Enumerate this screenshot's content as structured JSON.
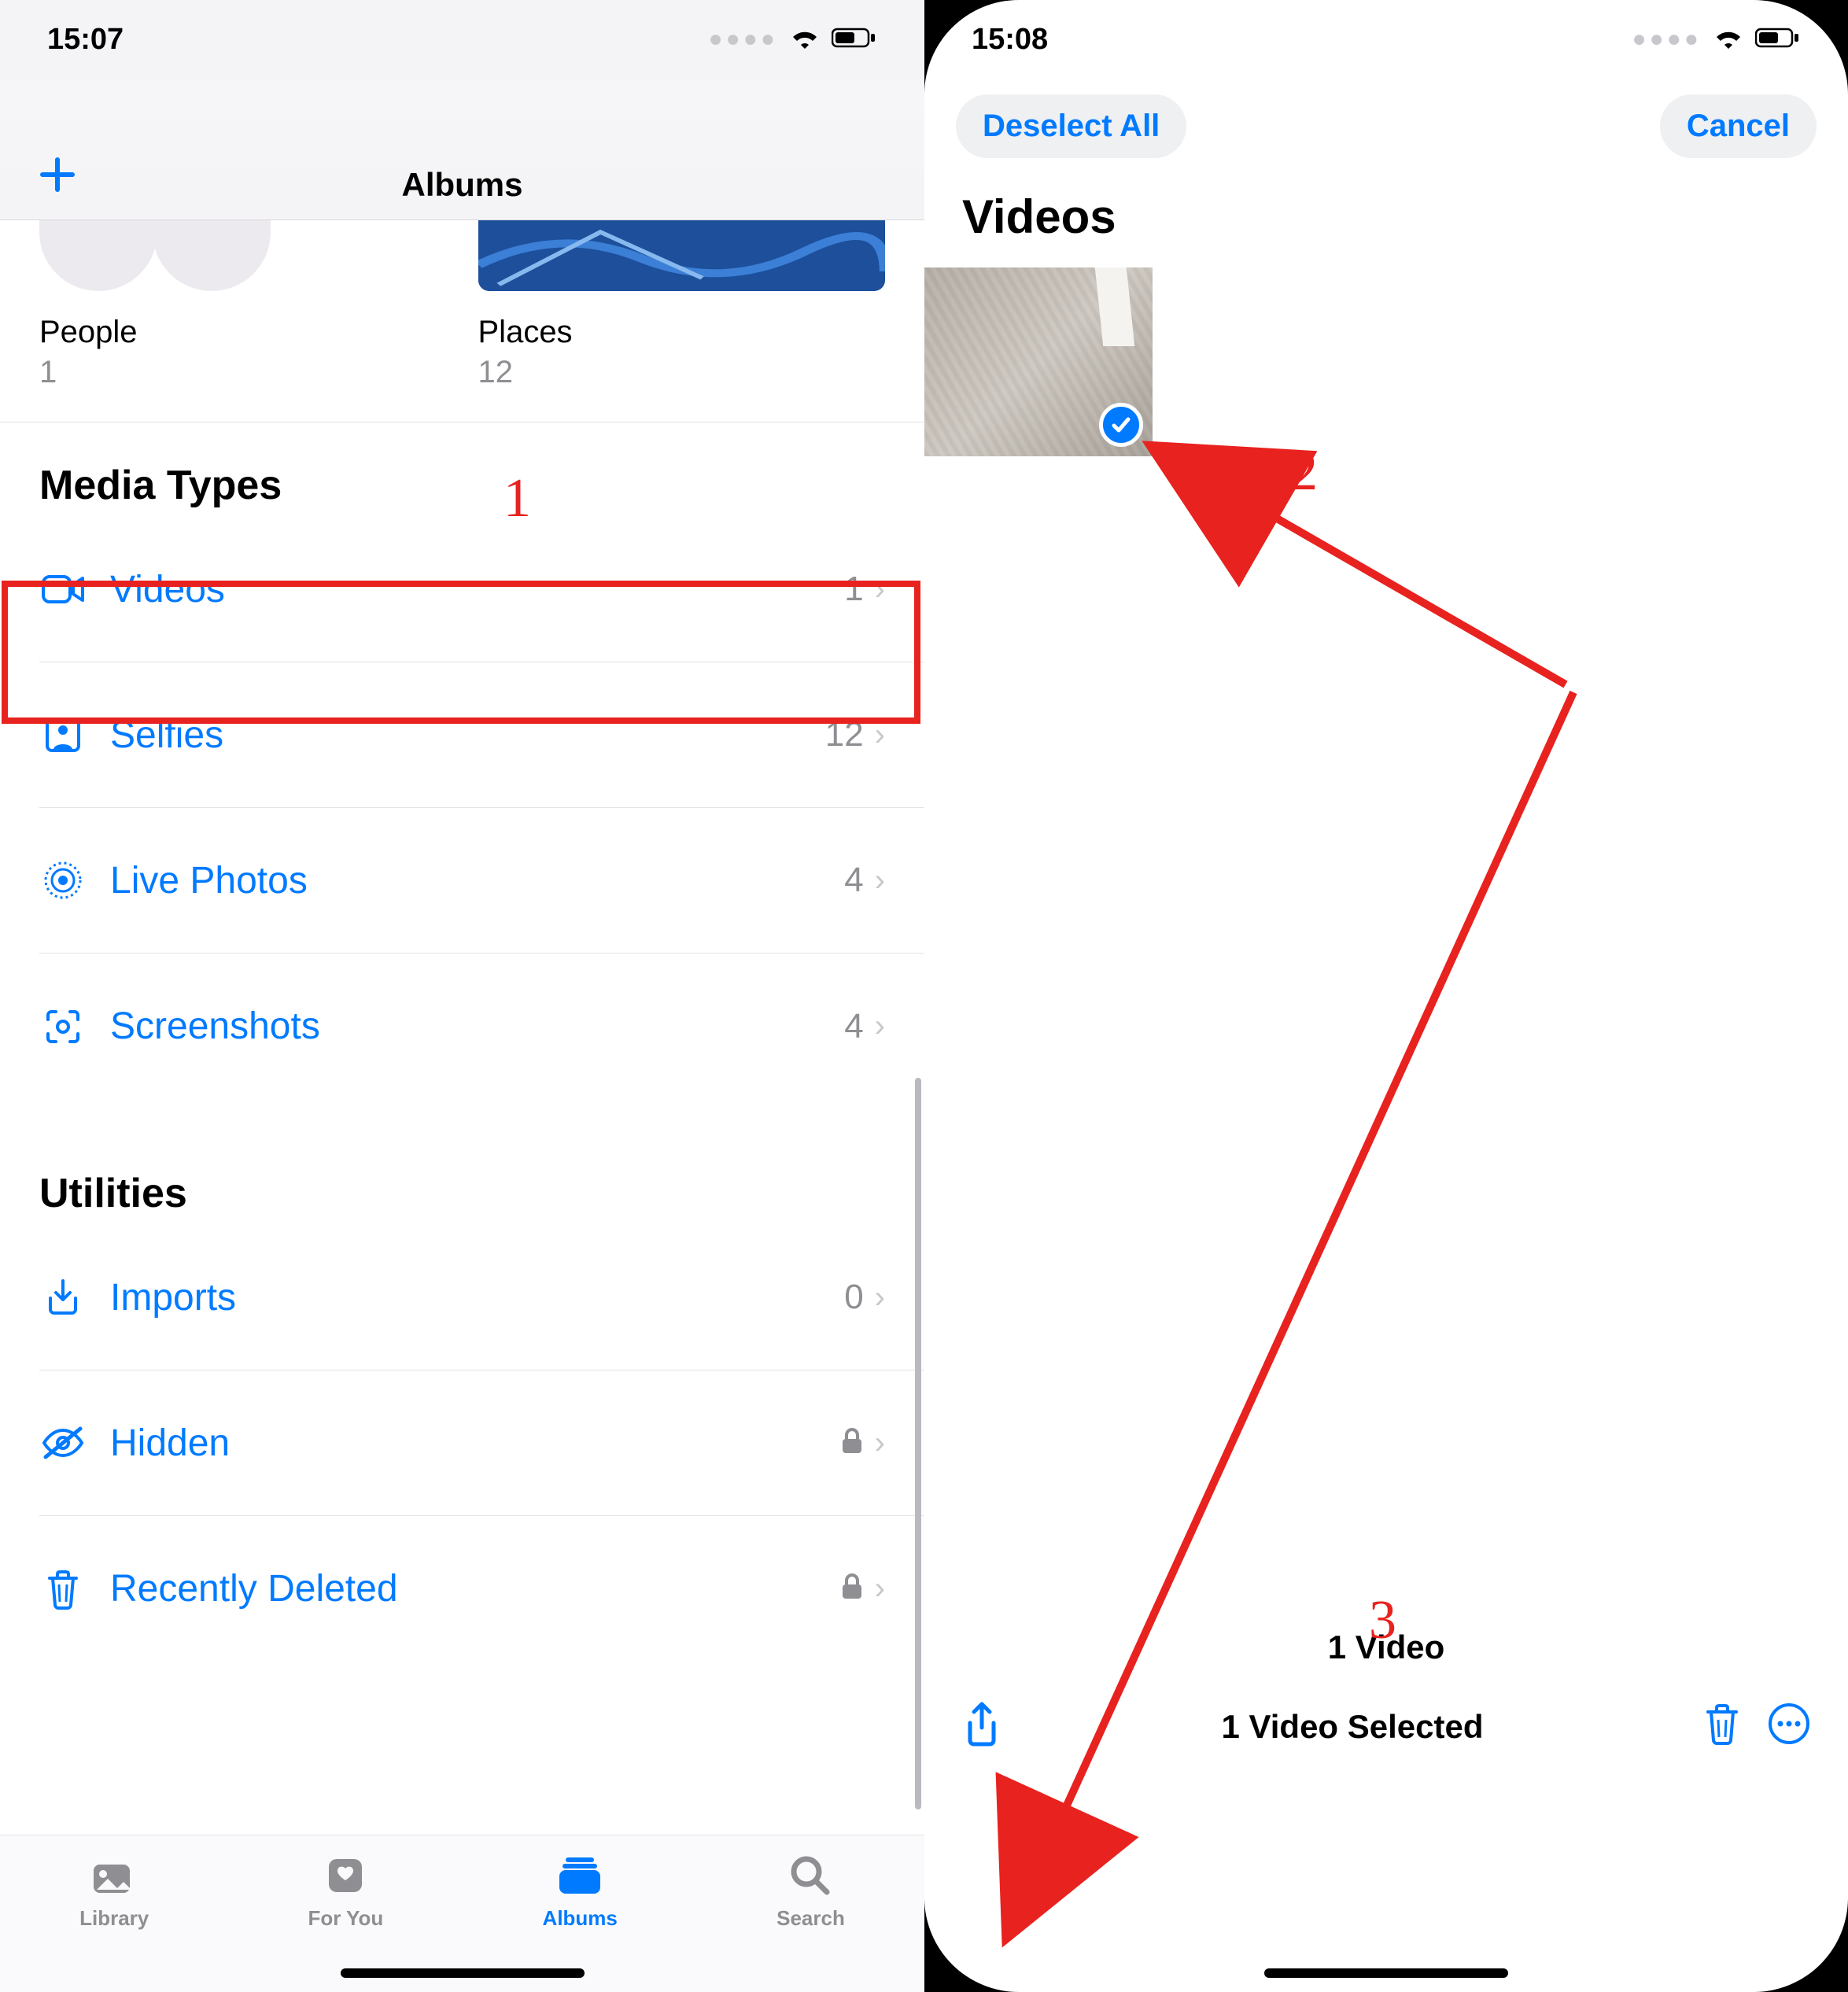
{
  "left": {
    "status": {
      "time": "15:07"
    },
    "header": {
      "title": "Albums"
    },
    "people_places": {
      "people": {
        "label": "People",
        "count": "1"
      },
      "places": {
        "label": "Places",
        "count": "12"
      }
    },
    "sections": {
      "media_types": {
        "title": "Media Types",
        "rows": [
          {
            "icon": "video-icon",
            "label": "Videos",
            "count": "1"
          },
          {
            "icon": "selfie-icon",
            "label": "Selfies",
            "count": "12"
          },
          {
            "icon": "livephoto-icon",
            "label": "Live Photos",
            "count": "4"
          },
          {
            "icon": "screenshot-icon",
            "label": "Screenshots",
            "count": "4"
          }
        ]
      },
      "utilities": {
        "title": "Utilities",
        "rows": [
          {
            "icon": "import-icon",
            "label": "Imports",
            "count": "0"
          },
          {
            "icon": "hidden-icon",
            "label": "Hidden",
            "locked": true
          },
          {
            "icon": "trash-icon",
            "label": "Recently Deleted",
            "locked": true
          }
        ]
      }
    },
    "tabs": {
      "library": "Library",
      "foryou": "For You",
      "albums": "Albums",
      "search": "Search"
    }
  },
  "right": {
    "status": {
      "time": "15:08"
    },
    "buttons": {
      "deselect": "Deselect All",
      "cancel": "Cancel"
    },
    "title": "Videos",
    "summary": "1 Video",
    "toolbar": {
      "selected": "1 Video Selected"
    }
  },
  "annotations": {
    "n1": "1",
    "n2": "2",
    "n3": "3"
  }
}
